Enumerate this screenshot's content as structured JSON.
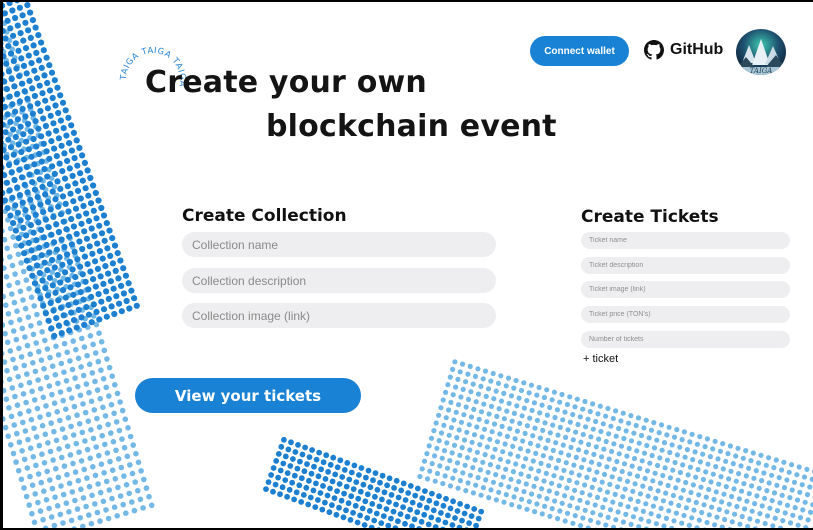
{
  "hero": {
    "line1": "Create your own",
    "line2": "blockchain event",
    "logo_text": "TAIGA TAIGA TAIGA"
  },
  "header": {
    "connect_wallet_label": "Connect wallet",
    "github_label": "GitHub",
    "avatar_text": "TAIGA"
  },
  "collection": {
    "title": "Create Collection",
    "name_placeholder": "Collection name",
    "description_placeholder": "Collection description",
    "image_placeholder": "Collection image (link)"
  },
  "tickets": {
    "title": "Create Tickets",
    "name_placeholder": "Ticket name",
    "description_placeholder": "Ticket description",
    "image_placeholder": "Ticket image (link)",
    "price_placeholder": "Ticket price (TON's)",
    "count_placeholder": "Number of tickets",
    "add_label": "+ ticket"
  },
  "actions": {
    "view_tickets_label": "View your tickets"
  },
  "colors": {
    "accent": "#1982d4",
    "dot_dark": "#1c7fd0",
    "dot_light": "#74b9e6",
    "input_bg": "#eeeef0"
  }
}
